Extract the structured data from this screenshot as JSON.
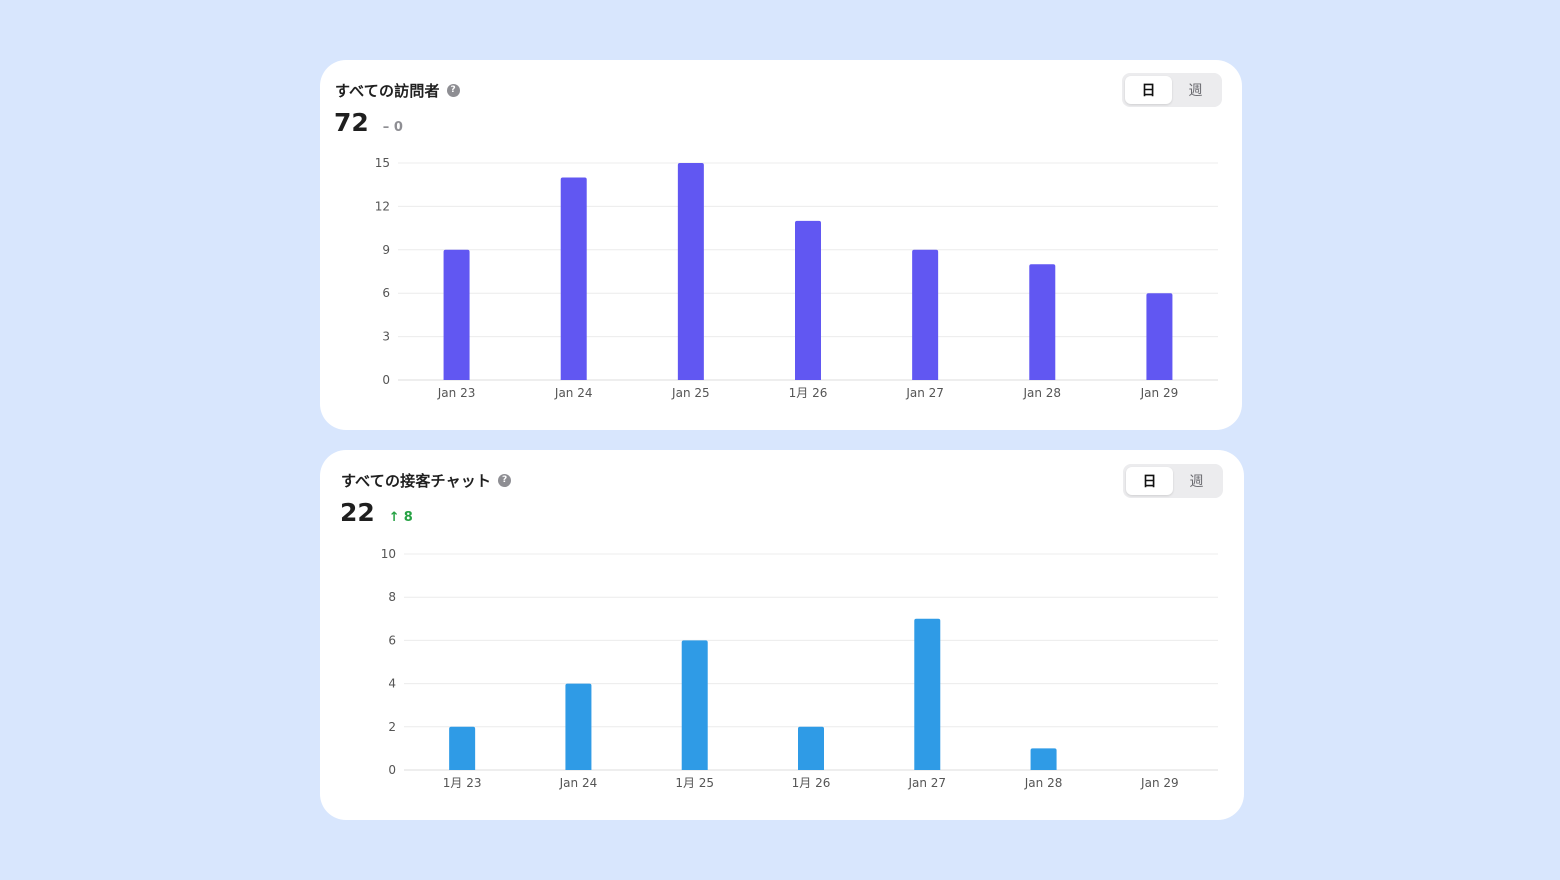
{
  "charts": [
    {
      "title": "すべての訪問者",
      "value": "72",
      "change": "– 0",
      "change_direction": "neutral",
      "toggle": {
        "day_label": "日",
        "week_label": "週",
        "active": "day"
      },
      "help_icon": "question-circle-icon"
    },
    {
      "title": "すべての接客チャット",
      "value": "22",
      "change": "8",
      "change_direction": "up",
      "change_icon": "arrow-up-icon",
      "toggle": {
        "day_label": "日",
        "week_label": "週",
        "active": "day"
      },
      "help_icon": "question-circle-icon"
    }
  ],
  "colors": {
    "background": "#d8e6fd",
    "visitors_bar": "#6157f2",
    "chats_bar": "#2f9be6",
    "change_up": "#26a244"
  },
  "chart_data": [
    {
      "type": "bar",
      "categories": [
        "Jan 23",
        "Jan 24",
        "Jan 25",
        "1月 26",
        "Jan 27",
        "Jan 28",
        "Jan 29"
      ],
      "values": [
        9,
        14,
        15,
        11,
        9,
        8,
        6
      ],
      "yticks": [
        0,
        3,
        6,
        9,
        12,
        15
      ],
      "ylim": [
        0,
        15
      ],
      "grid": true,
      "color": "#6157f2"
    },
    {
      "type": "bar",
      "categories": [
        "1月 23",
        "Jan 24",
        "1月 25",
        "1月 26",
        "Jan 27",
        "Jan 28",
        "Jan 29"
      ],
      "values": [
        2,
        4,
        6,
        2,
        7,
        1,
        0
      ],
      "yticks": [
        0,
        2,
        4,
        6,
        8,
        10
      ],
      "ylim": [
        0,
        10
      ],
      "grid": true,
      "color": "#2f9be6"
    }
  ]
}
